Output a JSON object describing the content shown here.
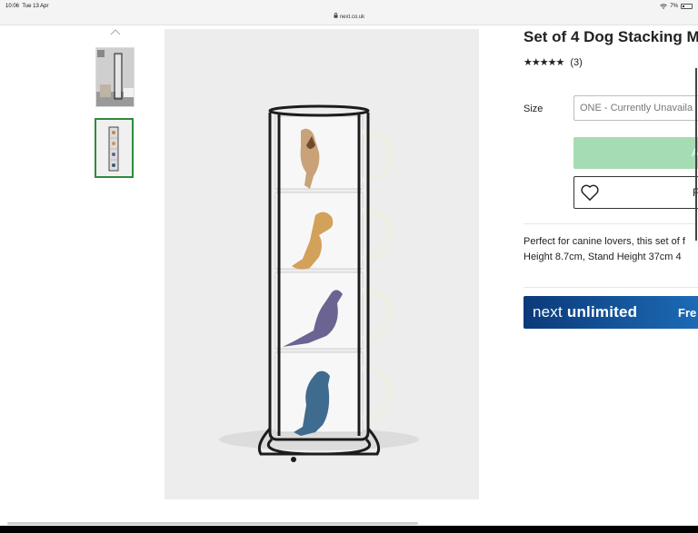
{
  "status_bar": {
    "time": "10:06",
    "date": "Tue 13 Apr",
    "wifi": "wifi-icon",
    "battery": "7%",
    "url": "next.co.uk"
  },
  "gallery": {
    "up_icon": "chevron-up-icon",
    "thumbnails": [
      "thumbnail-1",
      "thumbnail-2"
    ],
    "selected_index": 1
  },
  "product": {
    "title": "Set of 4 Dog Stacking M",
    "stars_text": "★★★★★",
    "rating": 4.5,
    "review_count": "(3)",
    "size_label": "Size",
    "size_value": "ONE - Currently Unavaila",
    "add_button_partial": "A",
    "favourite_partial": "F",
    "description_line1": "Perfect for canine lovers, this set of f",
    "description_line2": "Height 8.7cm, Stand Height 37cm 4"
  },
  "promo": {
    "brand_next": "next",
    "brand_unlimited": "unlimited",
    "cta_partial": "Fre"
  },
  "colors": {
    "accent_green": "#2e8b3d",
    "add_button": "#a6dcb4",
    "banner_dark": "#0b3a7a",
    "banner_light": "#1d6cb8"
  }
}
